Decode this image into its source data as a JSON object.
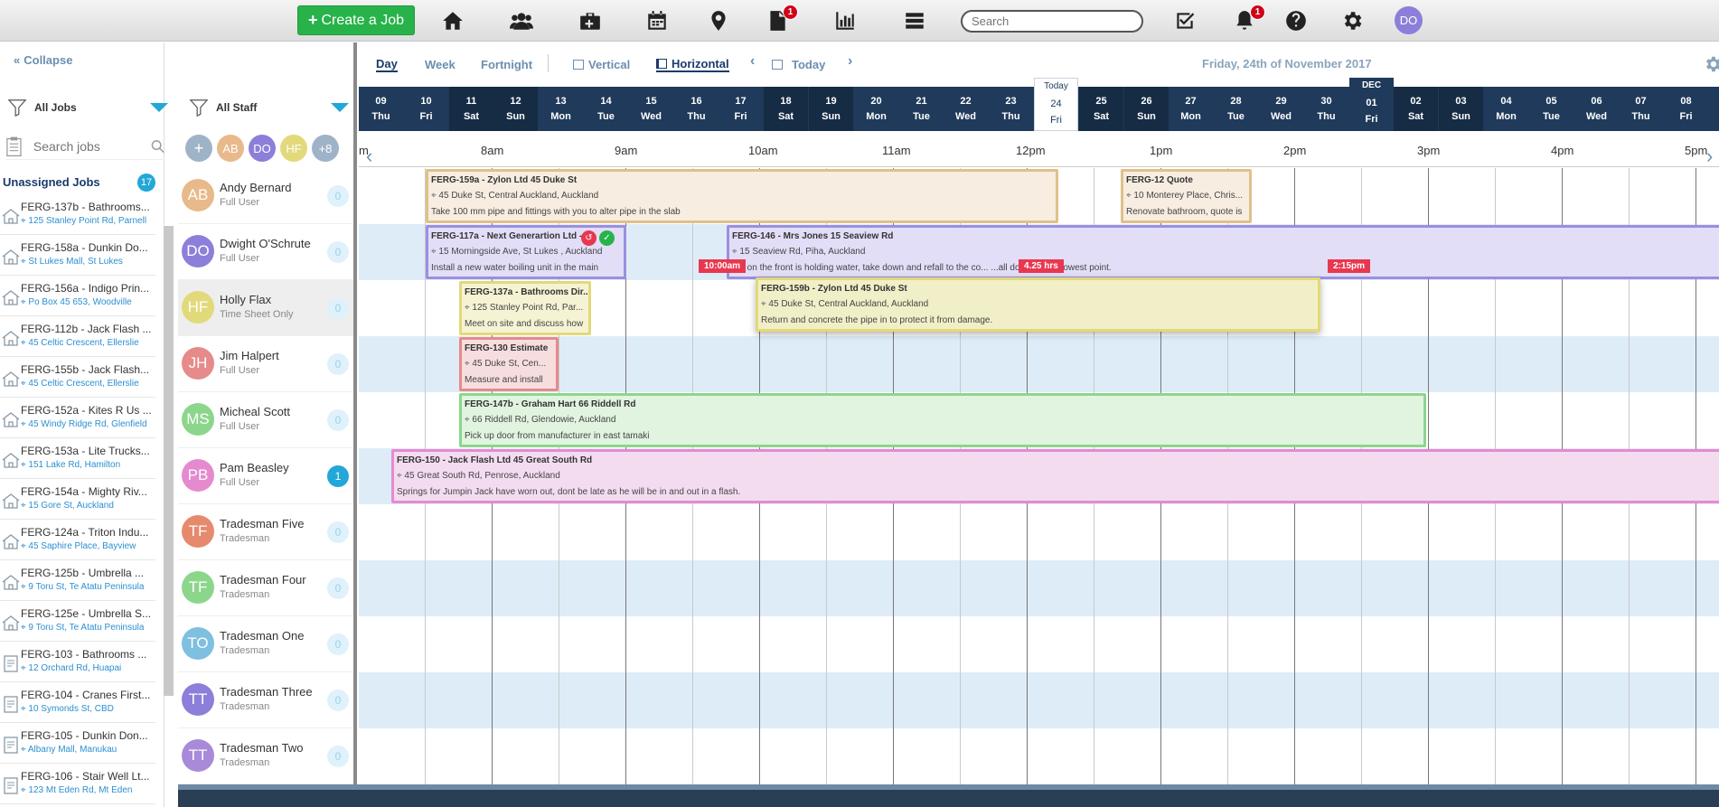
{
  "topbar": {
    "create_label": "Create a Job",
    "search_placeholder": "Search",
    "documents_badge": "1",
    "notifications_badge": "1",
    "user_initials": "DO"
  },
  "jobs_panel": {
    "collapse_label": "Collapse",
    "filter_label": "All Jobs",
    "search_placeholder": "Search jobs",
    "unassigned_label": "Unassigned Jobs",
    "unassigned_count": "17",
    "jobs": [
      {
        "title": "FERG-137b - Bathrooms...",
        "address": "125 Stanley Point Rd, Parnell",
        "icon": "house-icon"
      },
      {
        "title": "FERG-158a - Dunkin Do...",
        "address": "St Lukes Mall, St Lukes",
        "icon": "house-icon"
      },
      {
        "title": "FERG-156a - Indigo Prin...",
        "address": "Po Box 45 653, Woodville",
        "icon": "house-icon"
      },
      {
        "title": "FERG-112b - Jack Flash ...",
        "address": "45 Celtic Crescent, Ellerslie",
        "icon": "house-icon"
      },
      {
        "title": "FERG-155b - Jack Flash...",
        "address": "45 Celtic Crescent, Ellerslie",
        "icon": "house-icon"
      },
      {
        "title": "FERG-152a - Kites R Us ...",
        "address": "45 Windy Ridge Rd, Glenfield",
        "icon": "house-icon"
      },
      {
        "title": "FERG-153a - Lite Trucks...",
        "address": "151 Lake Rd, Hamilton",
        "icon": "house-icon"
      },
      {
        "title": "FERG-154a - Mighty Riv...",
        "address": "15 Gore St, Auckland",
        "icon": "house-icon"
      },
      {
        "title": "FERG-124a - Triton Indu...",
        "address": "45 Saphire Place, Bayview",
        "icon": "house-icon"
      },
      {
        "title": "FERG-125b - Umbrella ...",
        "address": "9 Toru St, Te Atatu Peninsula",
        "icon": "house-icon"
      },
      {
        "title": "FERG-125e - Umbrella S...",
        "address": "9 Toru St, Te Atatu Peninsula",
        "icon": "house-icon"
      },
      {
        "title": "FERG-103 - Bathrooms ...",
        "address": "12 Orchard Rd, Huapai",
        "icon": "quote-icon"
      },
      {
        "title": "FERG-104 - Cranes First...",
        "address": "10 Symonds St, CBD",
        "icon": "quote-icon"
      },
      {
        "title": "FERG-105 - Dunkin Don...",
        "address": "Albany Mall, Manukau",
        "icon": "quote-icon"
      },
      {
        "title": "FERG-106 - Stair Well Lt...",
        "address": "123 Mt Eden Rd, Mt Eden",
        "icon": "quote-icon"
      }
    ]
  },
  "staff_panel": {
    "filter_label": "All Staff",
    "avatars": [
      {
        "initials": "AB",
        "color": "#e8b98a"
      },
      {
        "initials": "DO",
        "color": "#8c7fd9"
      },
      {
        "initials": "HF",
        "color": "#e2d97a"
      },
      {
        "initials": "+8",
        "color": "#9fb3c8"
      }
    ],
    "staff": [
      {
        "initials": "AB",
        "name": "Andy Bernard",
        "role": "Full User",
        "count": "0",
        "color": "#e8b98a"
      },
      {
        "initials": "DO",
        "name": "Dwight O'Schrute",
        "role": "Full User",
        "count": "0",
        "color": "#8c7fd9"
      },
      {
        "initials": "HF",
        "name": "Holly Flax",
        "role": "Time Sheet Only",
        "count": "0",
        "color": "#e2d97a"
      },
      {
        "initials": "JH",
        "name": "Jim Halpert",
        "role": "Full User",
        "count": "0",
        "color": "#e68a8a"
      },
      {
        "initials": "MS",
        "name": "Micheal Scott",
        "role": "Full User",
        "count": "0",
        "color": "#8cd68c"
      },
      {
        "initials": "PB",
        "name": "Pam Beasley",
        "role": "Full User",
        "count": "1",
        "color": "#e68ad0"
      },
      {
        "initials": "TF",
        "name": "Tradesman Five",
        "role": "Tradesman",
        "count": "0",
        "color": "#e68a6e"
      },
      {
        "initials": "TF",
        "name": "Tradesman Four",
        "role": "Tradesman",
        "count": "0",
        "color": "#8cd68c"
      },
      {
        "initials": "TO",
        "name": "Tradesman One",
        "role": "Tradesman",
        "count": "0",
        "color": "#7fbfe0"
      },
      {
        "initials": "TT",
        "name": "Tradesman Three",
        "role": "Tradesman",
        "count": "0",
        "color": "#8c7fd9"
      },
      {
        "initials": "TT",
        "name": "Tradesman Two",
        "role": "Tradesman",
        "count": "0",
        "color": "#a98ad9"
      }
    ]
  },
  "view": {
    "day": "Day",
    "week": "Week",
    "fortnight": "Fortnight",
    "vertical": "Vertical",
    "horizontal": "Horizontal",
    "today": "Today",
    "date_title": "Friday, 24th of November 2017"
  },
  "dates": [
    {
      "n": "09",
      "d": "Thu",
      "we": false
    },
    {
      "n": "10",
      "d": "Fri",
      "we": false
    },
    {
      "n": "11",
      "d": "Sat",
      "we": true
    },
    {
      "n": "12",
      "d": "Sun",
      "we": true
    },
    {
      "n": "13",
      "d": "Mon",
      "we": false
    },
    {
      "n": "14",
      "d": "Tue",
      "we": false
    },
    {
      "n": "15",
      "d": "Wed",
      "we": false
    },
    {
      "n": "16",
      "d": "Thu",
      "we": false
    },
    {
      "n": "17",
      "d": "Fri",
      "we": false
    },
    {
      "n": "18",
      "d": "Sat",
      "we": true
    },
    {
      "n": "19",
      "d": "Sun",
      "we": true
    },
    {
      "n": "20",
      "d": "Mon",
      "we": false
    },
    {
      "n": "21",
      "d": "Tue",
      "we": false
    },
    {
      "n": "22",
      "d": "Wed",
      "we": false
    },
    {
      "n": "23",
      "d": "Thu",
      "we": false
    },
    {
      "n": "24",
      "d": "Fri",
      "we": false,
      "label": "Today"
    },
    {
      "n": "25",
      "d": "Sat",
      "we": true
    },
    {
      "n": "26",
      "d": "Sun",
      "we": true
    },
    {
      "n": "27",
      "d": "Mon",
      "we": false
    },
    {
      "n": "28",
      "d": "Tue",
      "we": false
    },
    {
      "n": "29",
      "d": "Wed",
      "we": false
    },
    {
      "n": "30",
      "d": "Thu",
      "we": false
    },
    {
      "n": "01",
      "d": "Fri",
      "we": false,
      "label": "DEC"
    },
    {
      "n": "02",
      "d": "Sat",
      "we": true
    },
    {
      "n": "03",
      "d": "Sun",
      "we": true
    },
    {
      "n": "04",
      "d": "Mon",
      "we": false
    },
    {
      "n": "05",
      "d": "Tue",
      "we": false
    },
    {
      "n": "06",
      "d": "Wed",
      "we": false
    },
    {
      "n": "07",
      "d": "Thu",
      "we": false
    },
    {
      "n": "08",
      "d": "Fri",
      "we": false
    }
  ],
  "hours": [
    "8am",
    "9am",
    "10am",
    "11am",
    "12pm",
    "1pm",
    "2pm",
    "3pm",
    "4pm",
    "5pm"
  ],
  "edge_hour": "m",
  "scheduled_jobs": [
    {
      "row": 0,
      "title": "FERG-159a - Zylon Ltd 45 Duke St",
      "address": "45 Duke St, Central Auckland, Auckland",
      "desc": "Take 100 mm pipe and fittings with you to alter pipe in the slab",
      "border": "#e0c08a",
      "bg": "#f7ede0"
    },
    {
      "row": 0,
      "title": "FERG-12 Quote",
      "address": "10 Monterey Place, Chris...",
      "desc": "Renovate bathroom, quote is",
      "border": "#e0c08a",
      "bg": "#f7ede0"
    },
    {
      "row": 1,
      "title": "FERG-117a - Next Generartion Ltd - 1",
      "address": "15 Morningside Ave, St Lukes , Auckland",
      "desc": "Install a new water boiling unit in the main",
      "border": "#9b8fe0",
      "bg": "#e2def7"
    },
    {
      "row": 1,
      "title": "FERG-146 - Mrs Jones 15 Seaview Rd",
      "address": "15 Seaview Rd, Piha, Auckland",
      "desc": "...g on the front is holding water, take down and refall to the co... ...all downpipe at lowest point.",
      "border": "#9b8fe0",
      "bg": "#e2def7"
    },
    {
      "row": 2,
      "title": "FERG-137a - Bathrooms Dir...",
      "address": "125 Stanley Point Rd, Par...",
      "desc": "Meet on site and discuss how",
      "border": "#e2d97a",
      "bg": "#f6f3d4"
    },
    {
      "row": 2,
      "title": "FERG-159b - Zylon Ltd 45 Duke St",
      "address": "45 Duke St, Central Auckland, Auckland",
      "desc": "Return and concrete the pipe in to protect it from damage.",
      "border": "#e2d97a",
      "bg": "#f1efc7"
    },
    {
      "row": 3,
      "title": "FERG-130 Estimate",
      "address": "45 Duke St, Cen...",
      "desc": "Measure and install",
      "border": "#e68a8a",
      "bg": "#f7dede"
    },
    {
      "row": 4,
      "title": "FERG-147b - Graham Hart 66 Riddell Rd",
      "address": "66 Riddell Rd, Glendowie, Auckland",
      "desc": "Pick up door from manufacturer in east tamaki",
      "border": "#8cd68c",
      "bg": "#e0f4e0"
    },
    {
      "row": 5,
      "title": "FERG-150 - Jack Flash Ltd 45 Great South Rd",
      "address": "45 Great South Rd, Penrose, Auckland",
      "desc": "Springs for Jumpin Jack have worn out, dont be late as he will be in and out in a flash.",
      "border": "#e68ad0",
      "bg": "#f4dcf0"
    }
  ],
  "drag_flags": {
    "start": "10:00am",
    "duration": "4.25 hrs",
    "end": "2:15pm"
  },
  "colors": {
    "accent": "#22a7d8",
    "nav_dark": "#1f3a5a",
    "create_green": "#27b34a",
    "flag_red": "#e8384f"
  }
}
